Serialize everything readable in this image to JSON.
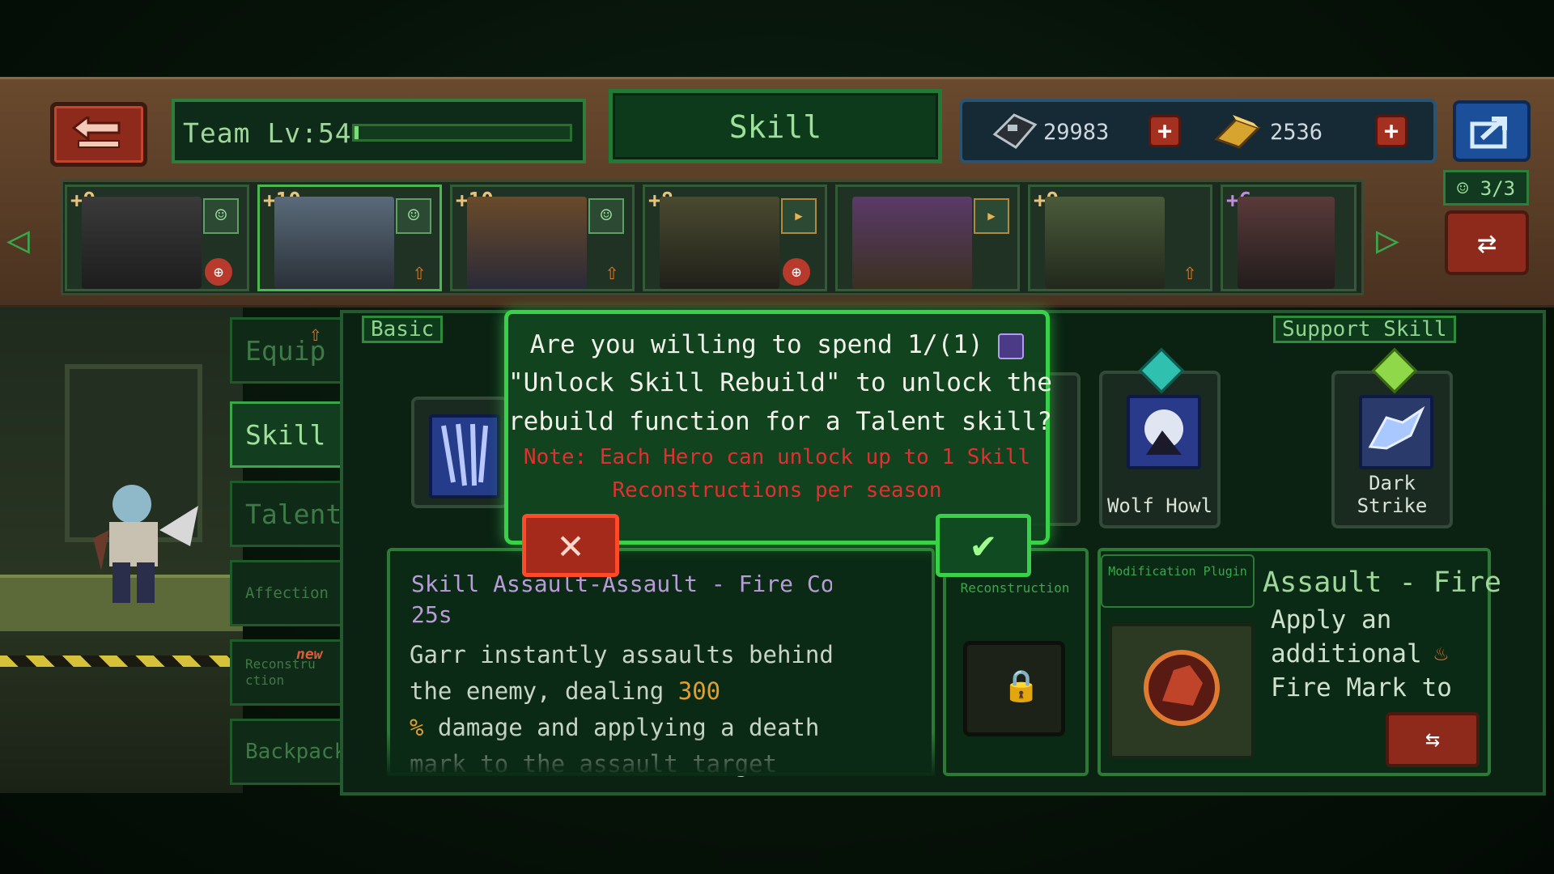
{
  "header": {
    "team_label": "Team Lv:54",
    "team_progress": 0.02,
    "title": "Skill",
    "currency1": "29983",
    "currency2": "2536",
    "plus": "+",
    "team_count": "3/3"
  },
  "heroes": [
    {
      "level": "+9"
    },
    {
      "level": "+10"
    },
    {
      "level": "+10"
    },
    {
      "level": "+8"
    },
    {
      "level": ""
    },
    {
      "level": "+9"
    },
    {
      "level": "+6"
    }
  ],
  "side_tabs": [
    "Equip",
    "Skill",
    "Talents",
    "Affection",
    "Reconstruction",
    "Backpack"
  ],
  "new_badge": "new",
  "sections": {
    "basic": "Basic",
    "support": "Support Skill"
  },
  "skills": {
    "wolf_howl": "Wolf Howl",
    "dark_strike": "Dark Strike"
  },
  "detail": {
    "title": "Skill Assault-Assault - Fire Co",
    "cooldown": "25s",
    "desc_a": "Garr instantly assaults behind the enemy, dealing ",
    "desc_hl1": "300",
    "desc_hl2": "%",
    "desc_b": " damage and applying a death mark to the assault target"
  },
  "reconstruction_label": "Reconstruction",
  "plugin": {
    "tag": "Modification Plugin",
    "title": "Assault - Fire",
    "desc": "Apply an additional Fire Mark to"
  },
  "dialog": {
    "line1_a": "Are you willing to spend 1/(1)",
    "line2": "\"Unlock Skill Rebuild\" to unlock the",
    "line3": "rebuild function for a Talent skill?",
    "note1": "Note: Each Hero can unlock up to 1 Skill",
    "note2": "Reconstructions per season",
    "cancel": "✕",
    "confirm": "✔"
  }
}
